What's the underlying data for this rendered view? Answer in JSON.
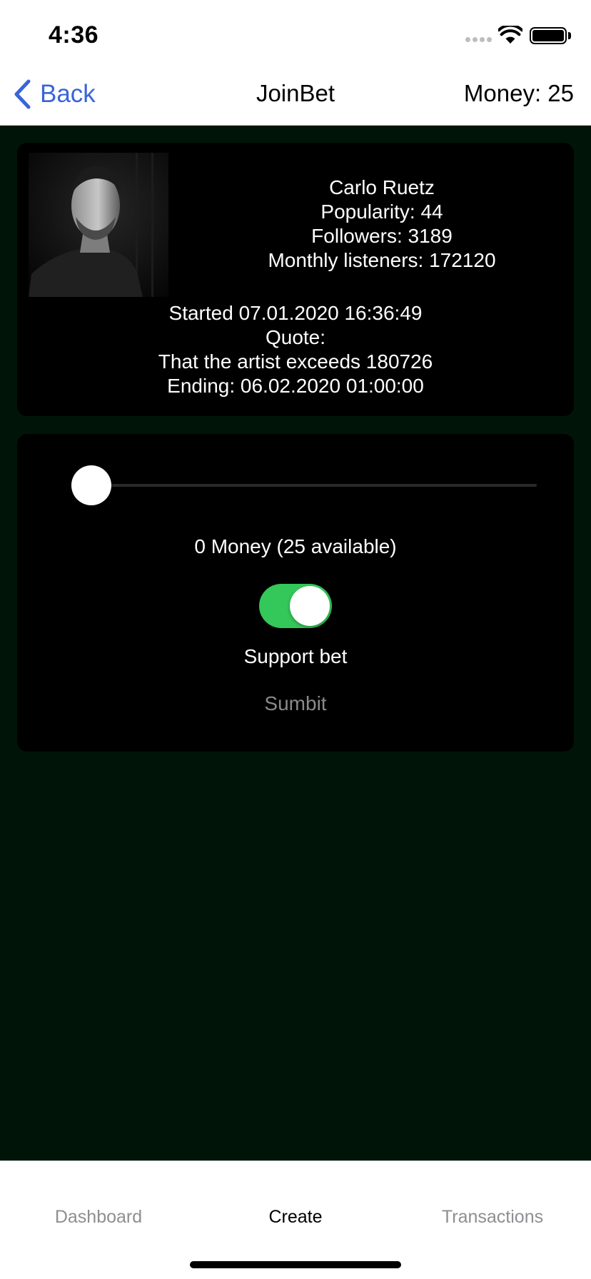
{
  "status_bar": {
    "time": "4:36"
  },
  "nav": {
    "back_label": "Back",
    "title": "JoinBet",
    "money": "Money: 25"
  },
  "artist": {
    "name": "Carlo Ruetz",
    "popularity": "Popularity: 44",
    "followers": "Followers: 3189",
    "monthly_listeners": "Monthly listeners: 172120"
  },
  "bet": {
    "started": "Started 07.01.2020 16:36:49",
    "quote_label": "Quote:",
    "quote": "That the artist exceeds 180726",
    "ending": "Ending: 06.02.2020 01:00:00"
  },
  "form": {
    "slider": {
      "value": 0,
      "min": 0,
      "max": 25
    },
    "amount_text": "0 Money (25 available)",
    "support_toggle_on": true,
    "support_label": "Support bet",
    "submit_label": "Sumbit"
  },
  "tabs": [
    {
      "label": "Dashboard",
      "active": false
    },
    {
      "label": "Create",
      "active": true
    },
    {
      "label": "Transactions",
      "active": false
    }
  ],
  "colors": {
    "background": "#001507",
    "card": "#000000",
    "accent_blue": "#3a64d8",
    "toggle_on": "#34c759",
    "submit_disabled": "#8a8a8a"
  }
}
